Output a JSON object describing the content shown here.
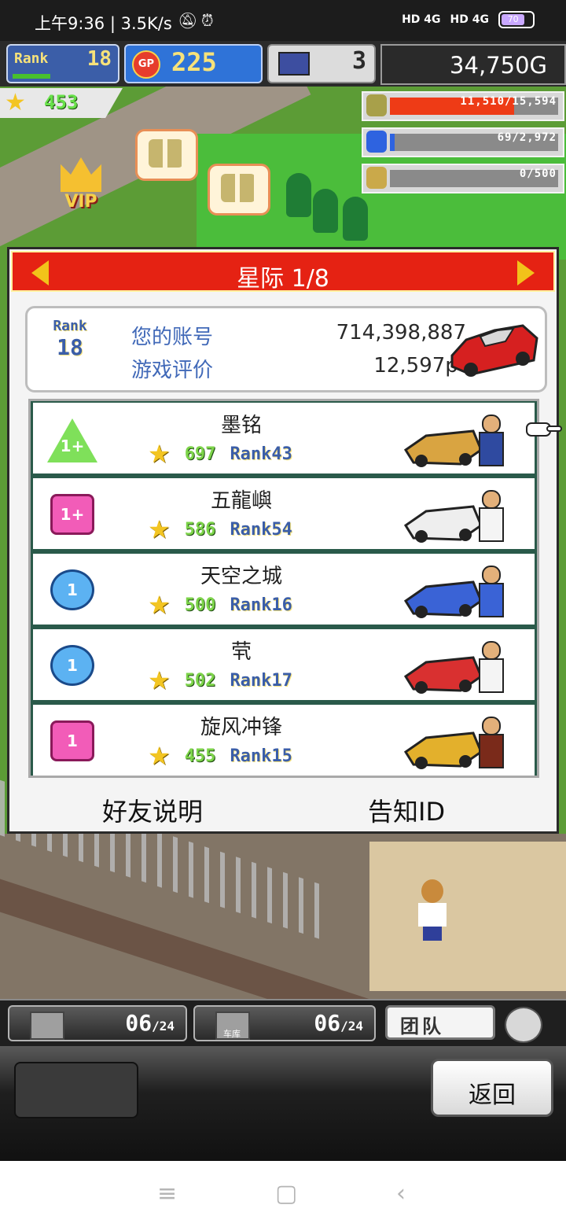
{
  "statusbar": {
    "time": "上午9:36 | 3.5K/s",
    "mute_icon": "bell-off-icon",
    "alarm_icon": "alarm-icon",
    "net1": "HD 4G",
    "net2": "HD 4G",
    "battery": "70"
  },
  "hud": {
    "rank_label": "Rank",
    "rank_value": "18",
    "gp_label": "GP",
    "gp_value": "225",
    "pc_value": "3",
    "money": "34,750G"
  },
  "scene": {
    "stars": "453",
    "vip": "VIP",
    "resources": [
      {
        "icon": "oil-barrel-icon",
        "text": "11,510/15,594",
        "fill": 0.74,
        "color": "#ee3b16"
      },
      {
        "icon": "fuel-can-icon",
        "text": "69/2,972",
        "fill": 0.03,
        "color": "#2e63e0"
      },
      {
        "icon": "wheat-icon",
        "text": "0/500",
        "fill": 0.0,
        "color": "#d8b94a"
      }
    ]
  },
  "dialog": {
    "title": "星际 1/8",
    "prev_icon": "arrow-left-icon",
    "next_icon": "arrow-right-icon",
    "summary": {
      "rank_label": "Rank",
      "rank_value": "18",
      "account_label": "您的账号",
      "account_value": "714,398,887",
      "rating_label": "游戏评价",
      "rating_value": "12,597pt"
    },
    "friends": [
      {
        "name": "墨铭",
        "badge": "1+",
        "badge_shape": "tri",
        "stars": "697",
        "rank_label": "Rank",
        "rank": "43",
        "car_color": "#d9a441"
      },
      {
        "name": "五龍嶼",
        "badge": "1+",
        "badge_shape": "sq",
        "stars": "586",
        "rank_label": "Rank",
        "rank": "54",
        "car_color": "#eeeeee"
      },
      {
        "name": "天空之城",
        "badge": "1",
        "badge_shape": "circ",
        "stars": "500",
        "rank_label": "Rank",
        "rank": "16",
        "car_color": "#3a63d6"
      },
      {
        "name": "茕",
        "badge": "1",
        "badge_shape": "circ",
        "stars": "502",
        "rank_label": "Rank",
        "rank": "17",
        "car_color": "#d93030"
      },
      {
        "name": "旋风冲锋",
        "badge": "1",
        "badge_shape": "sq",
        "stars": "455",
        "rank_label": "Rank",
        "rank": "15",
        "car_color": "#e3b02c"
      }
    ],
    "footer": {
      "friend_help": "好友说明",
      "notify_id": "告知ID"
    }
  },
  "toolbar": {
    "slot1_count": "06",
    "slot1_total": "/24",
    "slot2_count": "06",
    "slot2_total": "/24",
    "slot2_caption": "车库",
    "team_label": "团队",
    "back_label": "返回"
  },
  "navbar": {
    "menu_icon": "≡",
    "home_icon": "▢",
    "back_icon": "‹"
  }
}
